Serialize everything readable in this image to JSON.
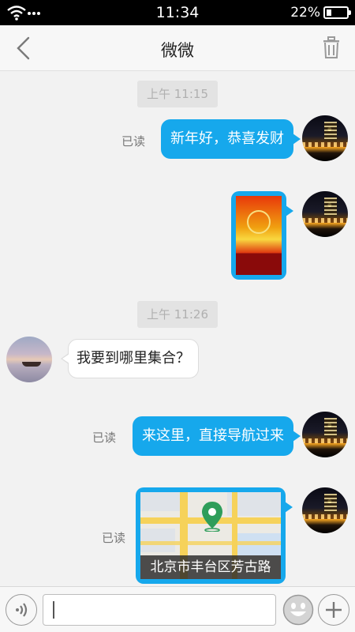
{
  "status_bar": {
    "time": "11:34",
    "battery": "22%",
    "battery_level": 0.22
  },
  "header": {
    "title": "微微"
  },
  "timestamps": [
    "上午 11:15",
    "上午 11:26"
  ],
  "messages": [
    {
      "text": "新年好，恭喜发财",
      "read": "已读"
    },
    {
      "read": ""
    },
    {
      "text": "我要到哪里集合？"
    },
    {
      "text": "来这里，直接导航过来",
      "read": "已读"
    },
    {
      "location": "北京市丰台区芳古路",
      "read": "已读"
    }
  ],
  "input": {
    "value": ""
  },
  "colors": {
    "bubble_out": "#16a8ec",
    "background": "#f2f2f2"
  }
}
